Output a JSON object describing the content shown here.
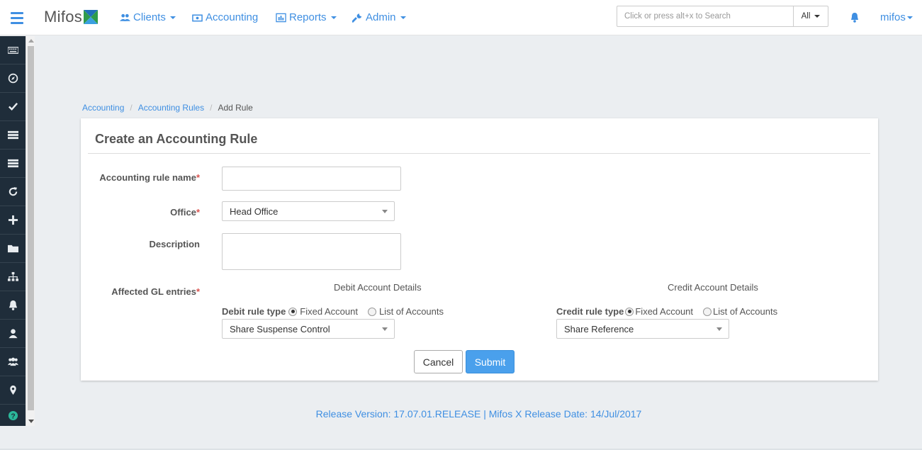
{
  "navbar": {
    "brand": "Mifos",
    "items": [
      {
        "label": "Clients",
        "icon": "users-icon"
      },
      {
        "label": "Accounting",
        "icon": "money-icon"
      },
      {
        "label": "Reports",
        "icon": "bar-chart-icon"
      },
      {
        "label": "Admin",
        "icon": "wrench-icon"
      }
    ],
    "search_placeholder": "Click or press alt+x to Search",
    "search_scope": "All",
    "user": "mifos"
  },
  "breadcrumb": {
    "items": [
      "Accounting",
      "Accounting Rules"
    ],
    "current": "Add Rule"
  },
  "form": {
    "title": "Create an Accounting Rule",
    "rule_name_label": "Accounting rule name",
    "rule_name_value": "",
    "office_label": "Office",
    "office_value": "Head Office",
    "description_label": "Description",
    "description_value": "",
    "affected_label": "Affected GL entries",
    "required_mark": "*",
    "debit": {
      "heading": "Debit Account Details",
      "rule_type_label": "Debit rule type",
      "option_fixed": "Fixed Account",
      "option_list": "List of Accounts",
      "selected": "fixed",
      "account_value": "Share Suspense Control"
    },
    "credit": {
      "heading": "Credit Account Details",
      "rule_type_label": "Credit rule type",
      "option_fixed": "Fixed Account",
      "option_list": "List of Accounts",
      "selected": "fixed",
      "account_value": "Share Reference"
    },
    "cancel_label": "Cancel",
    "submit_label": "Submit"
  },
  "footer": {
    "text": "Release Version: 17.07.01.RELEASE | Mifos X Release Date: 14/Jul/2017"
  },
  "colors": {
    "accent": "#3f8fe2",
    "sidebar_bg": "#1f2d3a",
    "page_bg": "#ebeef1",
    "submit_bg": "#4aa0ec",
    "required": "#d9534f"
  }
}
